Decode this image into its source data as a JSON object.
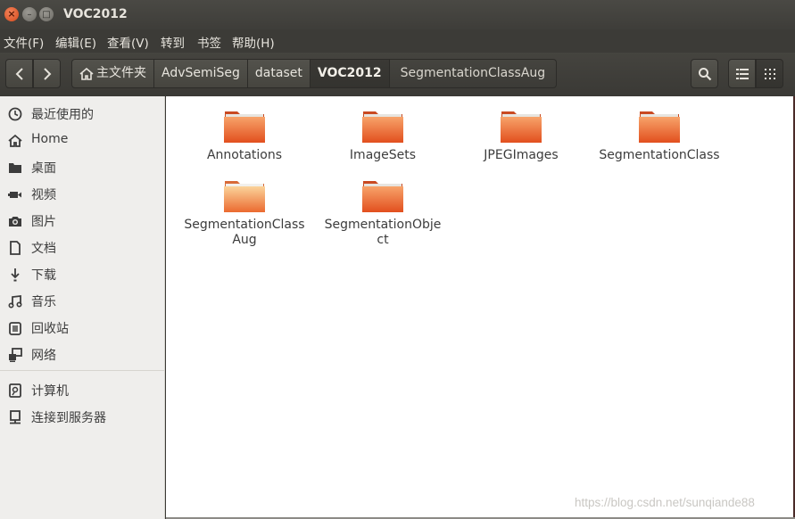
{
  "window": {
    "title": "VOC2012"
  },
  "menubar": {
    "items": [
      "文件(F)",
      "编辑(E)",
      "查看(V)",
      "转到",
      "书签",
      "帮助(H)"
    ]
  },
  "toolbar": {
    "breadcrumbs": [
      "主文件夹",
      "AdvSemiSeg",
      "dataset",
      "VOC2012",
      "SegmentationClassAug"
    ],
    "active_crumb": "VOC2012",
    "icons": [
      "back-arrow-icon",
      "forward-arrow-icon",
      "home-icon",
      "search-icon",
      "list-view-icon",
      "grid-view-icon"
    ]
  },
  "sidebar": {
    "items": [
      {
        "label": "最近使用的",
        "icon": "recent-clock-icon"
      },
      {
        "label": "Home",
        "icon": "home-icon"
      },
      {
        "label": "桌面",
        "icon": "desktop-folder-icon"
      },
      {
        "label": "视频",
        "icon": "video-icon"
      },
      {
        "label": "图片",
        "icon": "camera-icon"
      },
      {
        "label": "文档",
        "icon": "document-icon"
      },
      {
        "label": "下载",
        "icon": "download-icon"
      },
      {
        "label": "音乐",
        "icon": "music-icon"
      },
      {
        "label": "回收站",
        "icon": "trash-icon"
      },
      {
        "label": "网络",
        "icon": "network-icon"
      }
    ],
    "devices": [
      {
        "label": "计算机",
        "icon": "computer-icon"
      },
      {
        "label": "连接到服务器",
        "icon": "server-icon"
      }
    ]
  },
  "files": [
    {
      "line1": "Annotations",
      "line2": ""
    },
    {
      "line1": "ImageSets",
      "line2": ""
    },
    {
      "line1": "JPEGImages",
      "line2": ""
    },
    {
      "line1": "SegmentationClass",
      "line2": ""
    },
    {
      "line1": "SegmentationClass",
      "line2": "Aug"
    },
    {
      "line1": "SegmentationObje",
      "line2": "ct"
    }
  ],
  "watermark": "https://blog.csdn.net/sunqiande88",
  "colors": {
    "folder_orange": "#e8602c",
    "titlebar": "#3e3d39",
    "sidebar_bg": "#efeeec",
    "close_button": "#e25a26"
  }
}
